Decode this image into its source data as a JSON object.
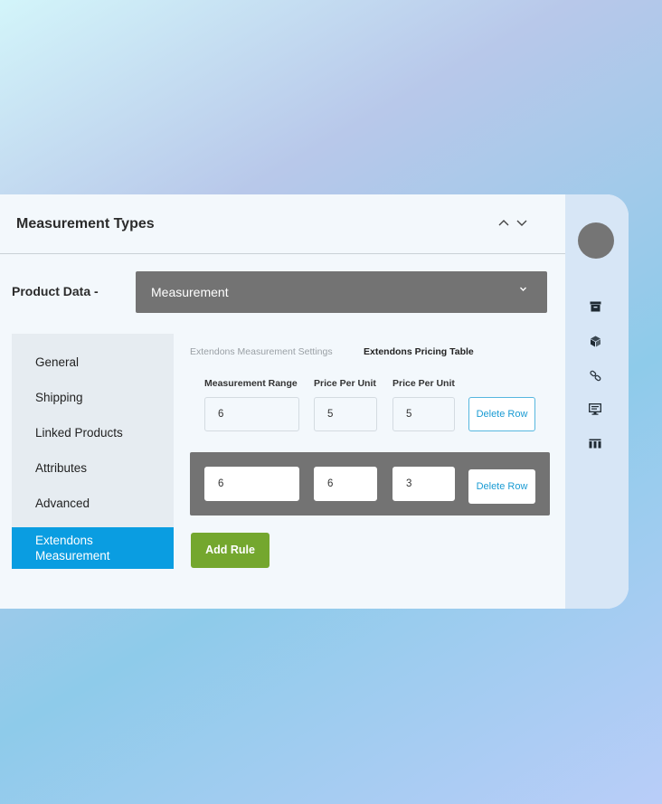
{
  "header": {
    "title": "Measurement Types"
  },
  "product_data": {
    "label": "Product Data -",
    "selected": "Measurement"
  },
  "tabs": [
    {
      "label": "General"
    },
    {
      "label": "Shipping"
    },
    {
      "label": "Linked Products"
    },
    {
      "label": "Attributes"
    },
    {
      "label": "Advanced"
    },
    {
      "label": "Extendons\nMeasurement",
      "active": true
    }
  ],
  "subtabs": [
    {
      "label": "Extendons Measurement Settings",
      "active": false
    },
    {
      "label": "Extendons Pricing Table",
      "active": true
    }
  ],
  "table": {
    "headers": [
      "Measurement Range",
      "Price Per Unit",
      "Price Per Unit"
    ],
    "rows": [
      {
        "values": [
          "6",
          "5",
          "5"
        ],
        "delete_label": "Delete Row"
      },
      {
        "values": [
          "6",
          "6",
          "3"
        ],
        "delete_label": "Delete Row"
      }
    ]
  },
  "add_rule_label": "Add Rule",
  "right_rail": {
    "icons": [
      "archive-icon",
      "cube-icon",
      "link-icon",
      "monitor-icon",
      "barcode-icon"
    ]
  },
  "colors": {
    "accent_blue": "#0a9de1",
    "add_green": "#74a72e",
    "select_gray": "#737373"
  }
}
